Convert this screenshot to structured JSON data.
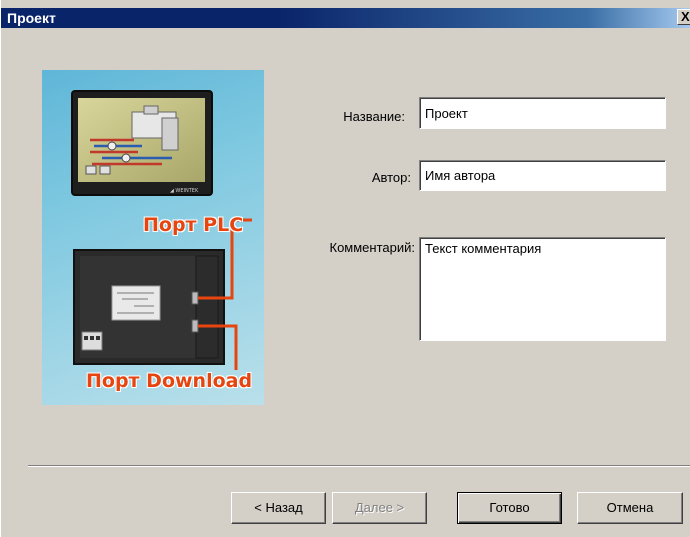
{
  "window": {
    "title": "Проект",
    "close_glyph": "X"
  },
  "illustration": {
    "port_plc": "Порт PLC",
    "port_download": "Порт Download"
  },
  "form": {
    "name_label": "Название:",
    "name_value": "Проект",
    "author_label": "Автор:",
    "author_value": "Имя автора",
    "comment_label": "Комментарий:",
    "comment_value": "Текст комментария"
  },
  "buttons": {
    "back": "< Назад",
    "next": "Далее >",
    "finish": "Готово",
    "cancel": "Отмена"
  },
  "colors": {
    "titlebar": "#0a246a",
    "dialog_bg": "#d4d0c8",
    "port_label": "#e64510"
  }
}
